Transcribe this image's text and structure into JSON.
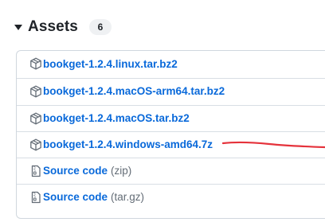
{
  "assets": {
    "title": "Assets",
    "count": "6",
    "items": [
      {
        "label": "bookget-1.2.4.linux.tar.bz2",
        "type": "package"
      },
      {
        "label": "bookget-1.2.4.macOS-arm64.tar.bz2",
        "type": "package"
      },
      {
        "label": "bookget-1.2.4.macOS.tar.bz2",
        "type": "package"
      },
      {
        "label": "bookget-1.2.4.windows-amd64.7z",
        "type": "package"
      },
      {
        "label": "Source code",
        "suffix": "(zip)",
        "type": "zip"
      },
      {
        "label": "Source code",
        "suffix": "(tar.gz)",
        "type": "zip"
      }
    ]
  },
  "colors": {
    "link": "#0969da",
    "muted": "#636c76",
    "annotation": "#e5323b"
  }
}
